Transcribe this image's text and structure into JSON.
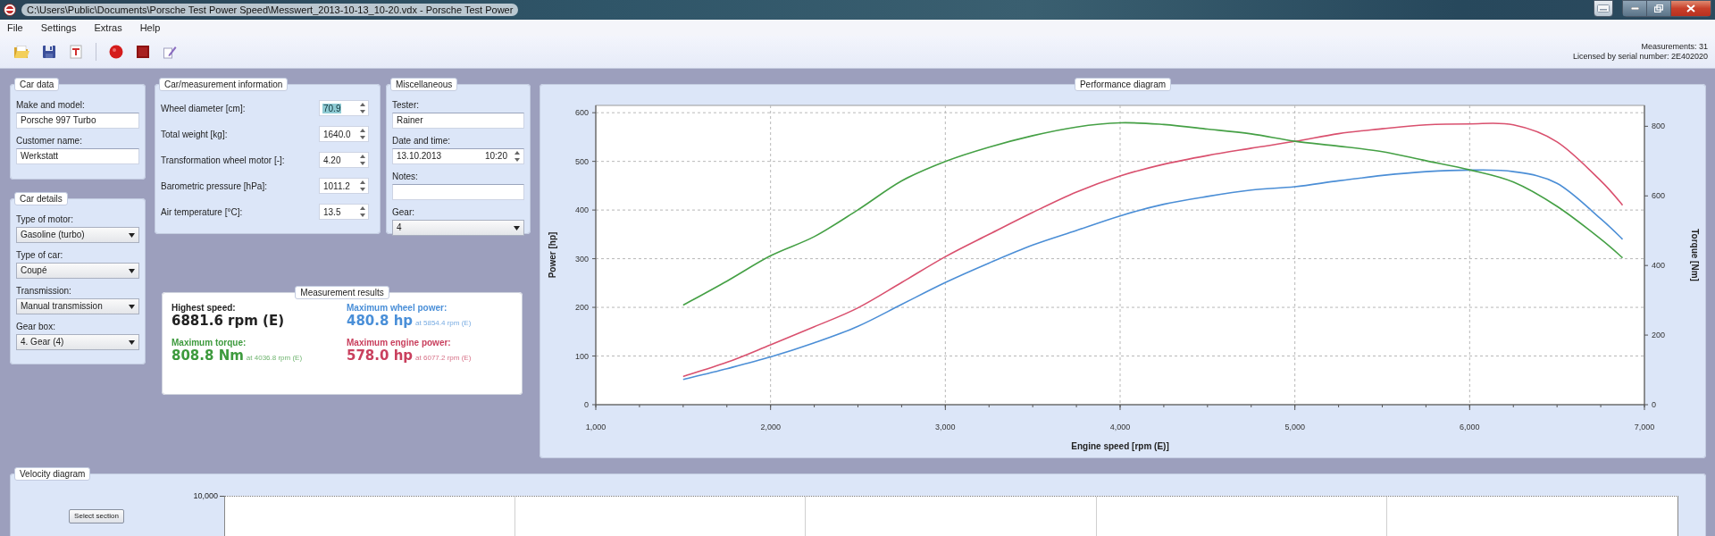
{
  "window": {
    "title": "C:\\Users\\Public\\Documents\\Porsche Test Power Speed\\Messwert_2013-10-13_10-20.vdx - Porsche Test Power"
  },
  "menu": [
    "File",
    "Settings",
    "Extras",
    "Help"
  ],
  "status": {
    "measurements": "Measurements: 31",
    "license": "Licensed by serial number: 2E402020"
  },
  "car_data": {
    "title": "Car data",
    "fields": [
      {
        "label": "Make and model:",
        "value": "Porsche 997 Turbo"
      },
      {
        "label": "Customer name:",
        "value": "Werkstatt"
      }
    ]
  },
  "car_details": {
    "title": "Car details",
    "fields": [
      {
        "label": "Type of motor:",
        "value": "Gasoline (turbo)"
      },
      {
        "label": "Type of car:",
        "value": "Coupé"
      },
      {
        "label": "Transmission:",
        "value": "Manual transmission"
      },
      {
        "label": "Gear box:",
        "value": "4. Gear (4)"
      }
    ]
  },
  "measurement_info": {
    "title": "Car/measurement information",
    "fields": [
      {
        "label": "Wheel diameter [cm]:",
        "value": "70.9",
        "focused": true
      },
      {
        "label": "Total weight [kg]:",
        "value": "1640.0",
        "focused": false
      },
      {
        "label": "Transformation wheel motor [-]:",
        "value": "4.20",
        "focused": false
      },
      {
        "label": "Barometric pressure [hPa]:",
        "value": "1011.2",
        "focused": false
      },
      {
        "label": "Air temperature [°C]:",
        "value": "13.5",
        "focused": false
      }
    ]
  },
  "miscellaneous": {
    "title": "Miscellaneous",
    "fields": [
      {
        "kind": "text",
        "label": "Tester:",
        "value": "Rainer"
      },
      {
        "kind": "datetime",
        "label": "Date and time:",
        "date": "13.10.2013",
        "time": "10:20"
      },
      {
        "kind": "text",
        "label": "Notes:"
      },
      {
        "kind": "select",
        "label": "Gear:",
        "value": "4"
      }
    ]
  },
  "results": {
    "title": "Measurement results",
    "items": [
      {
        "label": "Highest speed:",
        "value": "6881.6 rpm (E)",
        "color": "#222222"
      },
      {
        "label": "Maximum wheel power:",
        "value": "480.8 hp",
        "detail": "at 5854.4 rpm (E)",
        "color": "#4a8fd8"
      },
      {
        "label": "Maximum torque:",
        "value": "808.8 Nm",
        "detail": "at 4036.8 rpm (E)",
        "color": "#3d9a3d"
      },
      {
        "label": "Maximum engine power:",
        "value": "578.0 hp",
        "detail": "at 6077.2 rpm (E)",
        "color": "#c9405e"
      }
    ]
  },
  "performance": {
    "chart_data": {
      "type": "line",
      "title": "Performance diagram",
      "xlabel": "Engine speed [rpm (E)]",
      "ylabel": "Power [hp]",
      "y2label": "Torque [Nm]",
      "x": [
        1500,
        1750,
        2000,
        2250,
        2500,
        2750,
        3000,
        3250,
        3500,
        3750,
        4000,
        4250,
        4500,
        4750,
        5000,
        5250,
        5500,
        5750,
        6000,
        6250,
        6500,
        6750,
        6875
      ],
      "series": [
        {
          "color": "#4b8ed6",
          "values": [
            52,
            74,
            98,
            127,
            161,
            206,
            251,
            291,
            328,
            358,
            388,
            412,
            428,
            441,
            448,
            460,
            471,
            479,
            482,
            479,
            455,
            382,
            340
          ]
        },
        {
          "color": "#d9506e",
          "values": [
            58,
            87,
            123,
            160,
            199,
            251,
            304,
            350,
            395,
            437,
            470,
            494,
            512,
            527,
            541,
            557,
            567,
            575,
            577,
            575,
            540,
            460,
            410
          ]
        },
        {
          "color": "#45a045",
          "axis": "y2",
          "values": [
            286,
            355,
            428,
            483,
            560,
            643,
            699,
            740,
            773,
            798,
            810,
            805,
            792,
            778,
            757,
            743,
            727,
            701,
            675,
            640,
            570,
            476,
            422
          ]
        }
      ],
      "xlim": [
        1000,
        7000
      ],
      "ylim": [
        0,
        615
      ],
      "y2lim": [
        0,
        860
      ],
      "xticks": [
        {
          "value": 1000,
          "label": "1,000"
        },
        {
          "value": 2000,
          "label": "2,000"
        },
        {
          "value": 3000,
          "label": "3,000"
        },
        {
          "value": 4000,
          "label": "4,000"
        },
        {
          "value": 5000,
          "label": "5,000"
        },
        {
          "value": 6000,
          "label": "6,000"
        },
        {
          "value": 7000,
          "label": "7,000"
        }
      ],
      "yticks": [
        0,
        100,
        200,
        300,
        400,
        500,
        600
      ],
      "y2ticks": [
        0,
        200,
        400,
        600,
        800
      ],
      "grid": true
    }
  },
  "velocity": {
    "title": "Velocity diagram",
    "button": "Select section",
    "y_tick_label": "10,000"
  }
}
